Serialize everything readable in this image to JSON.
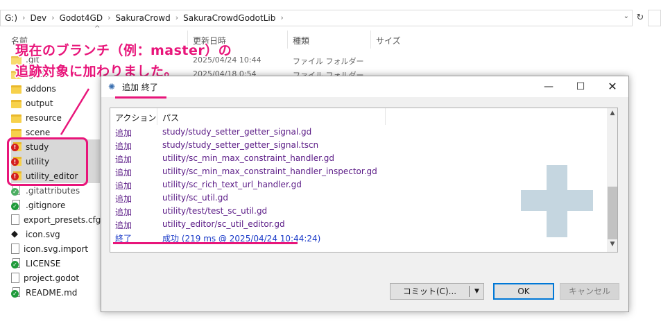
{
  "explorer": {
    "breadcrumbs": [
      "G:)",
      "Dev",
      "Godot4GD",
      "SakuraCrowd",
      "SakuraCrowdGodotLib"
    ],
    "columns": {
      "name": "名前",
      "date": "更新日時",
      "type": "種類",
      "size": "サイズ"
    },
    "rows": [
      {
        "name": ".git",
        "date": "2025/04/24 10:44",
        "type": "ファイル フォルダー"
      },
      {
        "name": ".godot",
        "date": "2025/04/18 0:54",
        "type": "ファイル フォルダー"
      },
      {
        "name": "addons"
      },
      {
        "name": "output"
      },
      {
        "name": "resource"
      },
      {
        "name": "scene"
      },
      {
        "name": "study"
      },
      {
        "name": "utility"
      },
      {
        "name": "utility_editor"
      },
      {
        "name": ".gitattributes"
      },
      {
        "name": ".gitignore"
      },
      {
        "name": "export_presets.cfg"
      },
      {
        "name": "icon.svg"
      },
      {
        "name": "icon.svg.import"
      },
      {
        "name": "LICENSE"
      },
      {
        "name": "project.godot"
      },
      {
        "name": "README.md"
      }
    ]
  },
  "annotation": {
    "line1": "現在のブランチ（例：master）の",
    "line2": "追跡対象に加わりました。",
    "color": "#e8157a"
  },
  "dialog": {
    "title": "追加 終了",
    "buttons": {
      "minimize": "—",
      "maximize": "☐",
      "close": "✕"
    },
    "list": {
      "headers": {
        "action": "アクション",
        "path": "パス"
      },
      "rows": [
        {
          "action": "追加",
          "path": "study/study_setter_getter_signal.gd"
        },
        {
          "action": "追加",
          "path": "study/study_setter_getter_signal.tscn"
        },
        {
          "action": "追加",
          "path": "utility/sc_min_max_constraint_handler.gd"
        },
        {
          "action": "追加",
          "path": "utility/sc_min_max_constraint_handler_inspector.gd"
        },
        {
          "action": "追加",
          "path": "utility/sc_rich_text_url_handler.gd"
        },
        {
          "action": "追加",
          "path": "utility/sc_util.gd"
        },
        {
          "action": "追加",
          "path": "utility/test/test_sc_util.gd"
        },
        {
          "action": "追加",
          "path": "utility_editor/sc_util_editor.gd"
        }
      ],
      "final": {
        "action": "終了",
        "path": "成功 (219 ms @ 2025/04/24 10:44:24)"
      }
    },
    "commit_button": "コミット(C)...",
    "ok_button": "OK",
    "cancel_button": "キャンセル",
    "colors": {
      "action_text": "#5a1a86",
      "done_text": "#1a3ac8",
      "plus_icon": "#c5d6e0"
    }
  }
}
